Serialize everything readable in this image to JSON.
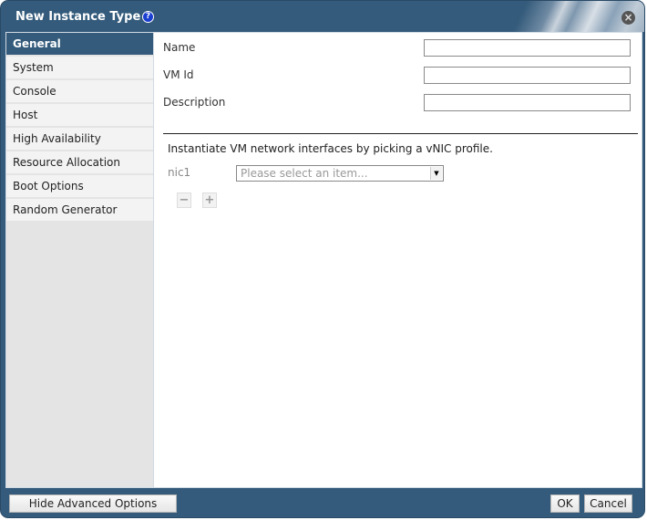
{
  "dialog": {
    "title": "New Instance Type",
    "help_icon": "?",
    "close_icon": "×"
  },
  "sidebar": {
    "items": [
      {
        "label": "General",
        "active": true
      },
      {
        "label": "System"
      },
      {
        "label": "Console"
      },
      {
        "label": "Host"
      },
      {
        "label": "High Availability"
      },
      {
        "label": "Resource Allocation"
      },
      {
        "label": "Boot Options"
      },
      {
        "label": "Random Generator"
      }
    ]
  },
  "general": {
    "fields": [
      {
        "label": "Name",
        "value": ""
      },
      {
        "label": "VM Id",
        "value": ""
      },
      {
        "label": "Description",
        "value": ""
      }
    ],
    "network_instructions": "Instantiate VM network interfaces by picking a vNIC profile.",
    "nic": {
      "label": "nic1",
      "placeholder": "Please select an item...",
      "arrow": "▼"
    },
    "remove_button": "−",
    "add_button": "+"
  },
  "footer": {
    "advanced_toggle": "Hide Advanced Options",
    "ok": "OK",
    "cancel": "Cancel"
  }
}
